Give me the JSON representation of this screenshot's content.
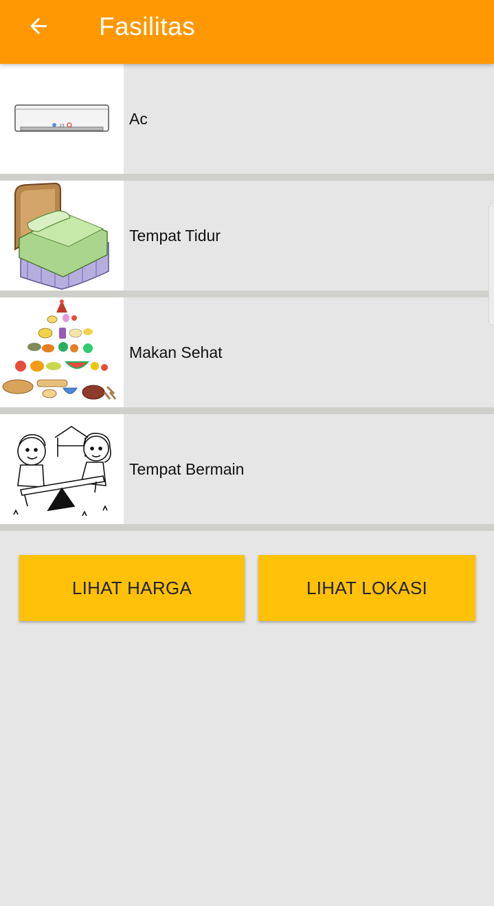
{
  "app_bar": {
    "title": "Fasilitas",
    "back_icon": "arrow-back-icon",
    "color": "#ff9800"
  },
  "facilities": [
    {
      "label": "Ac",
      "icon": "air-conditioner-image"
    },
    {
      "label": "Tempat Tidur",
      "icon": "bed-image"
    },
    {
      "label": "Makan Sehat",
      "icon": "food-pyramid-image"
    },
    {
      "label": "Tempat Bermain",
      "icon": "playground-kids-image"
    }
  ],
  "actions": {
    "harga_label": "LIHAT HARGA",
    "lokasi_label": "LIHAT LOKASI",
    "button_color": "#ffc107"
  },
  "ac_display": "23"
}
